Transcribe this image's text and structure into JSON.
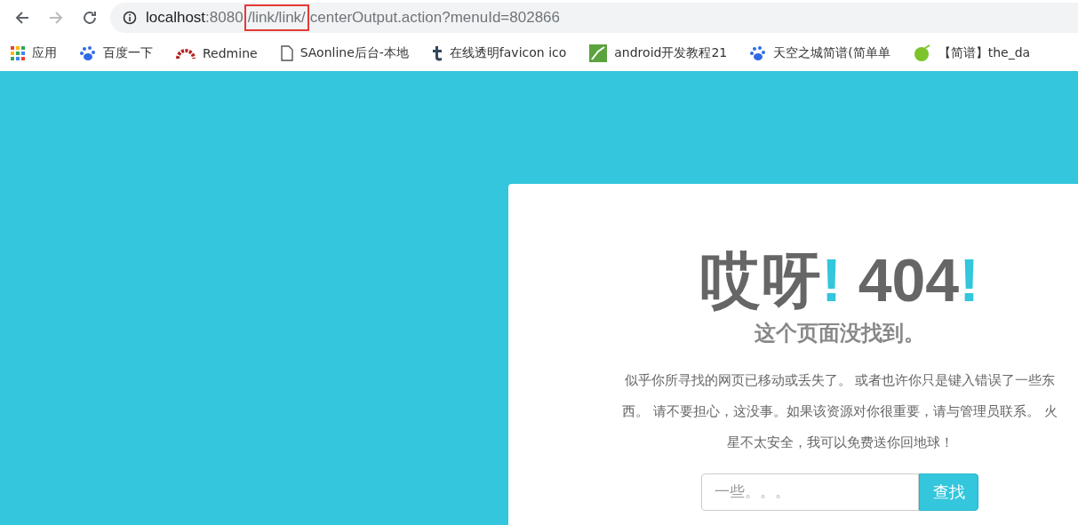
{
  "browser": {
    "url": {
      "host": "localhost",
      "port": ":8080",
      "highlighted": "/link/link/",
      "rest": "centerOutput.action?menuId=802866"
    },
    "bookmarks": [
      {
        "kind": "apps",
        "label": "应用"
      },
      {
        "kind": "paw",
        "label": "百度一下"
      },
      {
        "kind": "redmine",
        "label": "Redmine"
      },
      {
        "kind": "page",
        "label": "SAonline后台-本地"
      },
      {
        "kind": "tumblr",
        "label": "在线透明favicon ico"
      },
      {
        "kind": "android",
        "label": "android开发教程21"
      },
      {
        "kind": "paw",
        "label": "天空之城简谱(简单单"
      },
      {
        "kind": "leaf",
        "label": "【简谱】the_da"
      }
    ]
  },
  "error": {
    "title": [
      {
        "text": "哎呀",
        "accent": false
      },
      {
        "text": "!",
        "accent": true
      },
      {
        "text": " 404",
        "accent": false
      },
      {
        "text": "!",
        "accent": true
      }
    ],
    "subtitle": "这个页面没找到。",
    "message": "似乎你所寻找的网页已移动或丢失了。 或者也许你只是键入错误了一些东西。 请不要担心，这没事。如果该资源对你很重要，请与管理员联系。 火星不太安全，我可以免费送你回地球！",
    "search": {
      "placeholder": "一些。。。",
      "button": "查找"
    }
  }
}
